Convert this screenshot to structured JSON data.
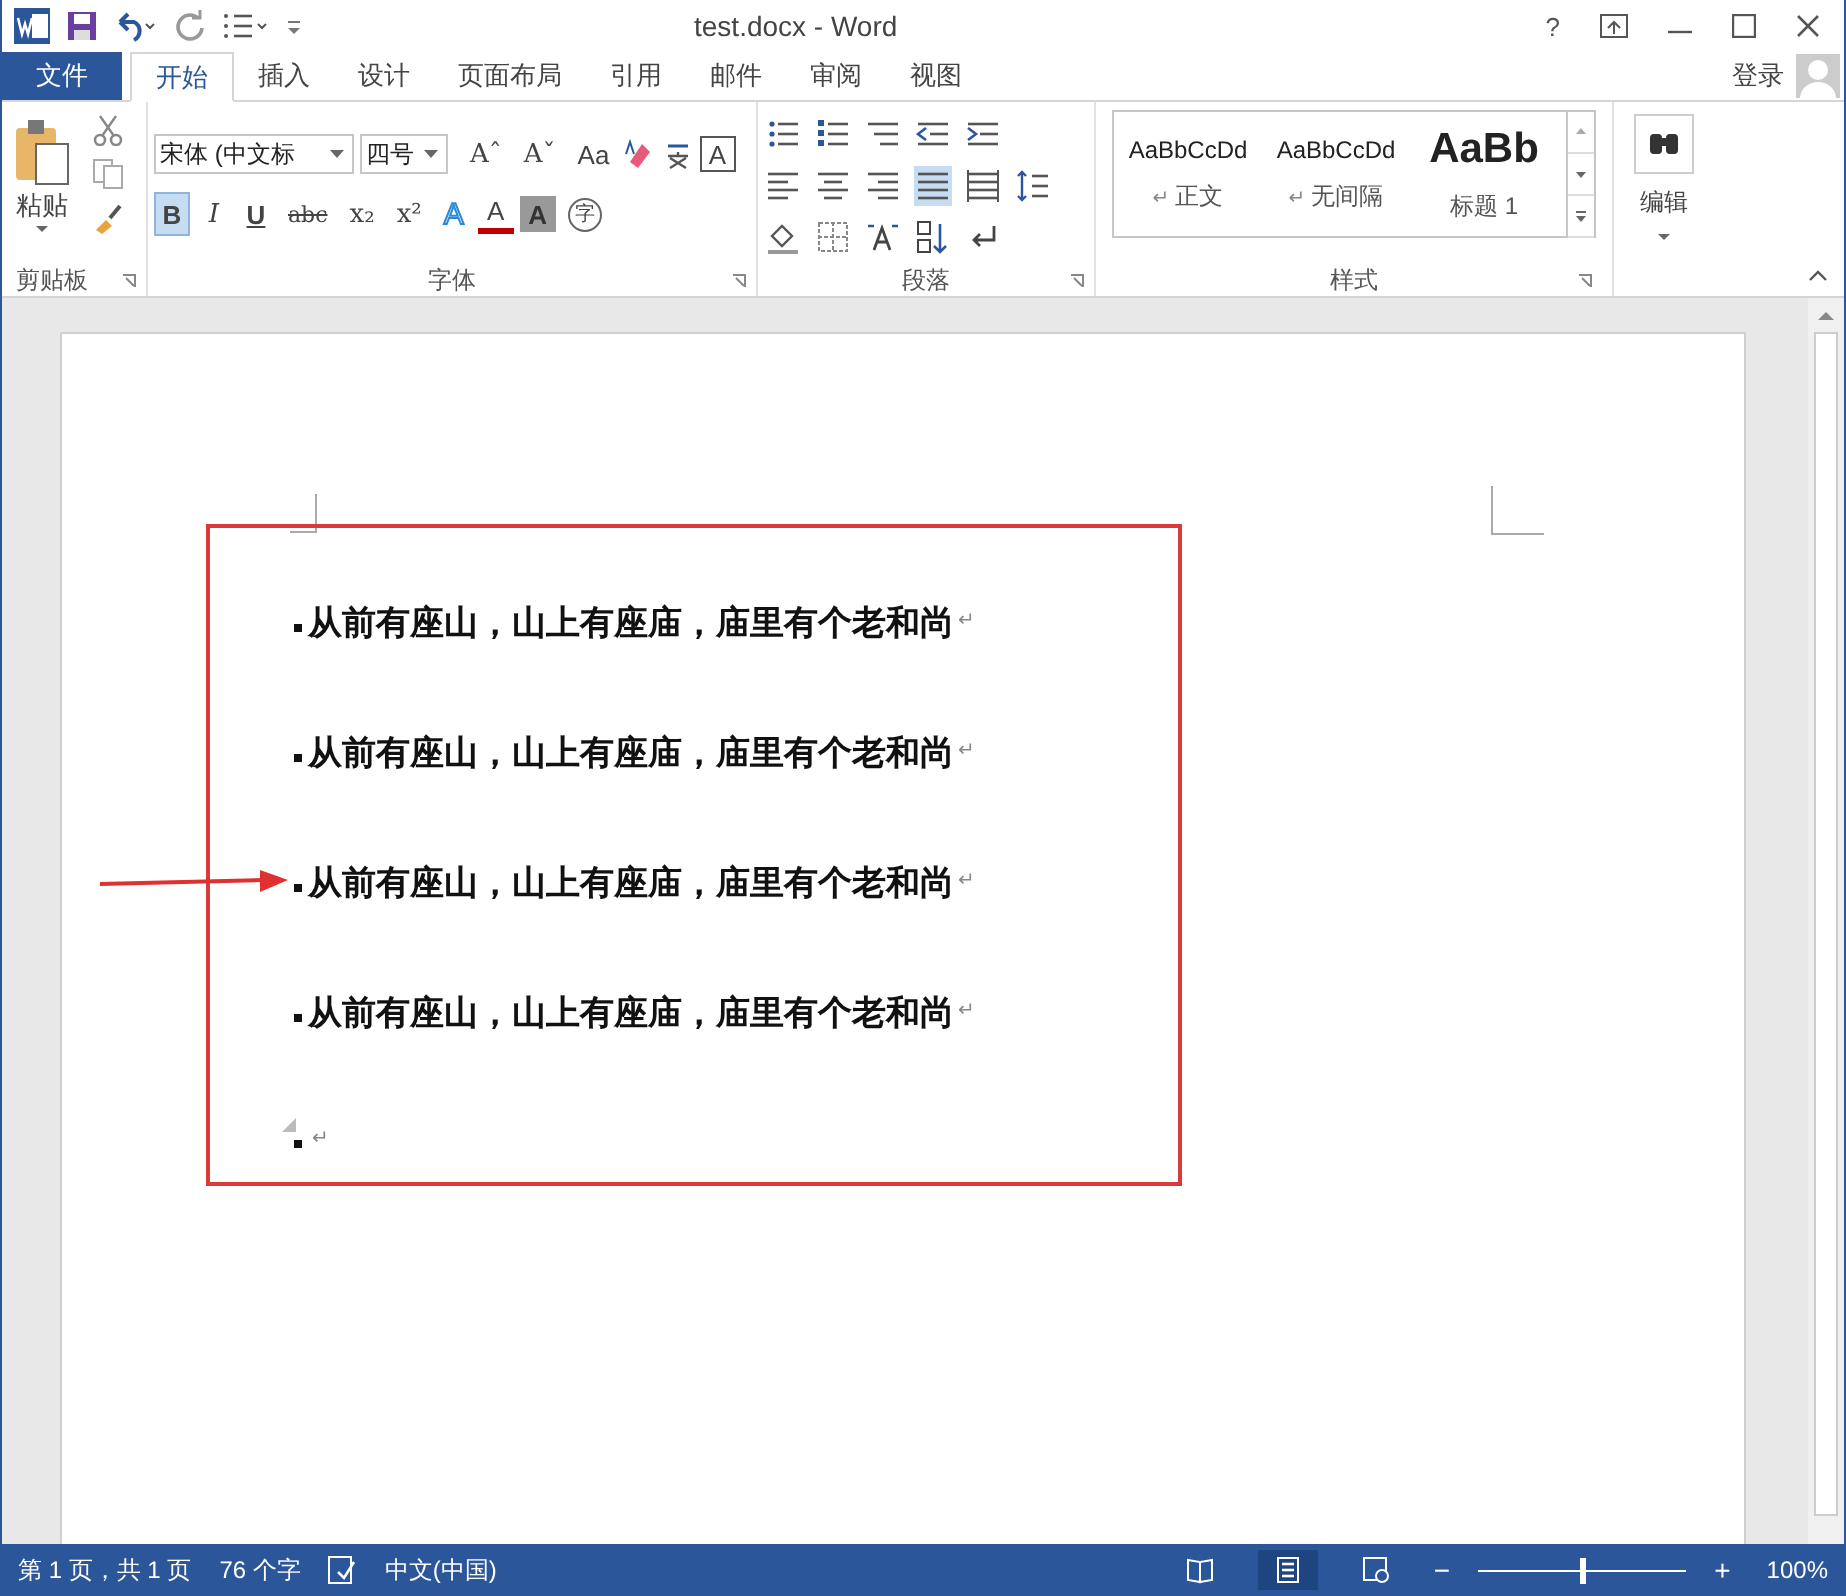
{
  "title_bar": {
    "title": "test.docx - Word",
    "help": "?"
  },
  "tabs": [
    {
      "label": "文件",
      "kind": "file",
      "selected": false
    },
    {
      "label": "开始",
      "kind": "tab",
      "selected": true
    },
    {
      "label": "插入",
      "kind": "tab",
      "selected": false
    },
    {
      "label": "设计",
      "kind": "tab",
      "selected": false
    },
    {
      "label": "页面布局",
      "kind": "tab",
      "selected": false
    },
    {
      "label": "引用",
      "kind": "tab",
      "selected": false
    },
    {
      "label": "邮件",
      "kind": "tab",
      "selected": false
    },
    {
      "label": "审阅",
      "kind": "tab",
      "selected": false
    },
    {
      "label": "视图",
      "kind": "tab",
      "selected": false
    }
  ],
  "account": {
    "label": "登录"
  },
  "ribbon": {
    "clipboard": {
      "label": "剪贴板",
      "paste": "粘贴"
    },
    "font": {
      "label": "字体",
      "font_name": "宋体 (中文标",
      "font_size": "四号",
      "row1": [
        {
          "text": "Aˆ",
          "kind": "plain",
          "selected": false
        },
        {
          "text": "Aˇ",
          "kind": "plain",
          "selected": false
        },
        {
          "text": "Aa",
          "kind": "dropdown",
          "selected": false
        },
        {
          "text": "A",
          "kind": "boxed",
          "selected": false
        }
      ],
      "row2": [
        {
          "text": "B",
          "kind": "bold",
          "selected": true
        },
        {
          "text": "I",
          "kind": "italic",
          "selected": false
        },
        {
          "text": "U",
          "kind": "underline",
          "selected": false
        },
        {
          "text": "abc",
          "kind": "strike",
          "selected": false
        },
        {
          "text": "x₂",
          "kind": "plain",
          "selected": false
        },
        {
          "text": "x²",
          "kind": "plain",
          "selected": false
        },
        {
          "text": "A",
          "kind": "outline",
          "selected": false
        },
        {
          "text": "A",
          "kind": "fontcolor",
          "selected": false
        },
        {
          "text": "A",
          "kind": "shaded",
          "selected": false
        },
        {
          "text": "字",
          "kind": "circled",
          "selected": false
        }
      ]
    },
    "paragraph": {
      "label": "段落",
      "buttons": [
        {
          "selected": false
        },
        {
          "selected": false
        },
        {
          "selected": false
        },
        {
          "selected": false
        },
        {
          "selected": false
        },
        {
          "selected": false
        },
        {
          "selected": false
        },
        {
          "selected": false
        },
        {
          "selected": true
        },
        {
          "selected": false
        },
        {
          "selected": false
        },
        {
          "selected": false
        },
        {
          "selected": false
        },
        {
          "selected": false
        },
        {
          "selected": false
        },
        {
          "selected": false
        }
      ]
    },
    "styles": {
      "label": "样式",
      "items": [
        {
          "sample": "AaBbCcDd",
          "name": "正文",
          "para_mark": "↵",
          "kind": "normal"
        },
        {
          "sample": "AaBbCcDd",
          "name": "无间隔",
          "para_mark": "↵",
          "kind": "normal"
        },
        {
          "sample": "AaBb",
          "name": "标题 1",
          "kind": "heading"
        }
      ]
    },
    "editing": {
      "label": "编辑"
    }
  },
  "document": {
    "paragraphs": [
      {
        "text": "从前有座山，山上有座庙，庙里有个老和尚",
        "mark": "↵"
      },
      {
        "text": "从前有座山，山上有座庙，庙里有个老和尚",
        "mark": "↵"
      },
      {
        "text": "从前有座山，山上有座庙，庙里有个老和尚",
        "mark": "↵"
      },
      {
        "text": "从前有座山，山上有座庙，庙里有个老和尚",
        "mark": "↵"
      },
      {
        "mark": "↵"
      }
    ]
  },
  "status_bar": {
    "items": [
      "第 1 页，共 1 页",
      "76 个字"
    ],
    "language": "中文(中国)",
    "views": [
      {
        "selected": false
      },
      {
        "selected": true
      },
      {
        "selected": false
      }
    ],
    "zoom": {
      "minus": "−",
      "plus": "+",
      "level": 0.5,
      "reading": "100%"
    }
  }
}
